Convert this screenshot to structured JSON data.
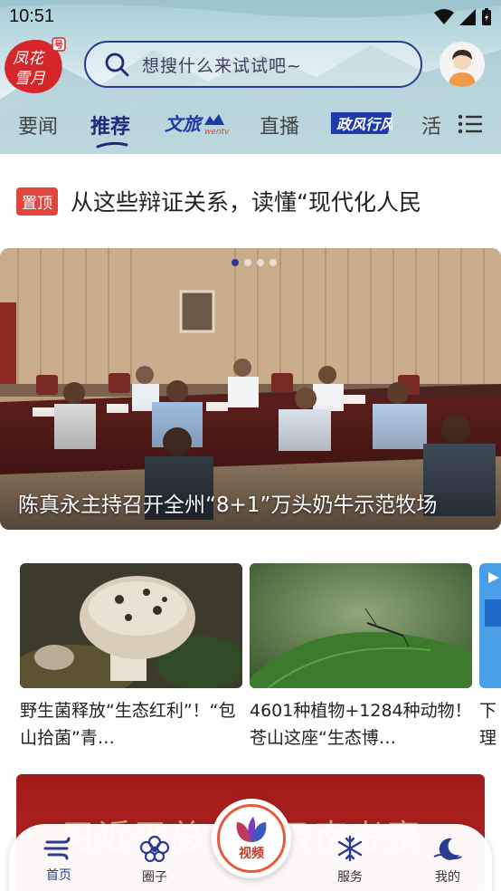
{
  "status_bar": {
    "time": "10:51"
  },
  "logo": {
    "line1": "凤花",
    "line2": "雪月",
    "badge": "号"
  },
  "search": {
    "placeholder": "想搜什么来试试吧~"
  },
  "tabs": [
    {
      "label": "要闻"
    },
    {
      "label": "推荐",
      "active": true
    },
    {
      "label": "文旅",
      "sub": "wentv"
    },
    {
      "label": "直播"
    },
    {
      "label": "政风行风"
    },
    {
      "label": "活"
    }
  ],
  "pinned": {
    "badge": "置顶",
    "title": "从这些辩证关系，读懂“现代化人民"
  },
  "hero": {
    "caption": "陈真永主持召开全州“8+1”万头奶牛示范牧场"
  },
  "cards": [
    {
      "title": "野生菌释放“生态红利”！“包山拾菌”青…"
    },
    {
      "title": "4601种植物+1284种动物！苍山这座“生态博…"
    },
    {
      "title": "下理"
    }
  ],
  "banner": {
    "text": "习近平总书记云南考察"
  },
  "bottom_nav": [
    {
      "label": "首页",
      "icon": "home-wind-icon",
      "active": true
    },
    {
      "label": "圈子",
      "icon": "flower-icon"
    },
    {
      "label": "视频",
      "icon": "butterfly-icon"
    },
    {
      "label": "服务",
      "icon": "snowflake-icon"
    },
    {
      "label": "我的",
      "icon": "moon-icon"
    }
  ],
  "colors": {
    "accent": "#2b3b8f",
    "pin": "#e2453c",
    "banner": "#b3231f"
  }
}
